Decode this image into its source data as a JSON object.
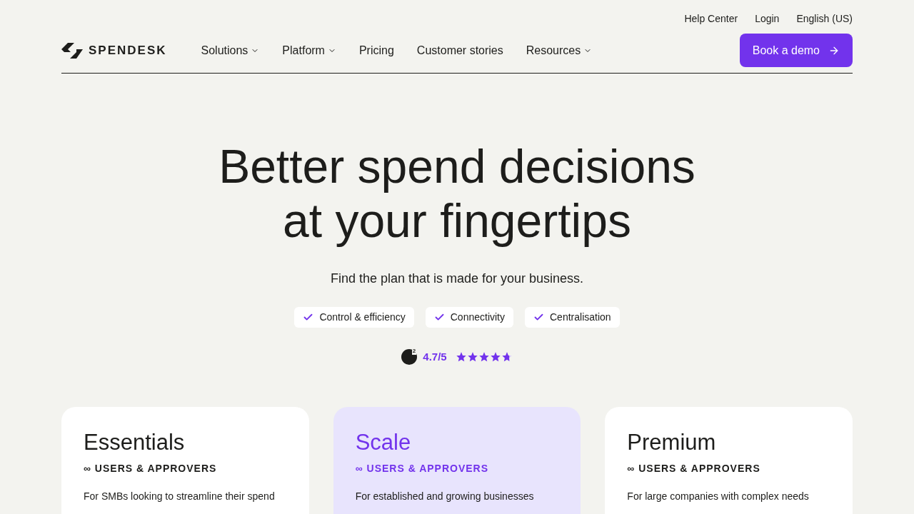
{
  "top_links": [
    "Help Center",
    "Login",
    "English (US)"
  ],
  "logo": {
    "text": "SPENDESK"
  },
  "nav": [
    {
      "label": "Solutions",
      "dropdown": true
    },
    {
      "label": "Platform",
      "dropdown": true
    },
    {
      "label": "Pricing",
      "dropdown": false
    },
    {
      "label": "Customer stories",
      "dropdown": false
    },
    {
      "label": "Resources",
      "dropdown": true
    }
  ],
  "cta": {
    "label": "Book a demo"
  },
  "hero": {
    "title_lines": [
      "Better spend decisions",
      "at your fingertips"
    ],
    "subtitle": "Find the plan that is made for your business.",
    "features": [
      "Control & efficiency",
      "Connectivity",
      "Centralisation"
    ],
    "rating": {
      "g2": "2",
      "score": "4.7/5",
      "stars": 4.7
    }
  },
  "plans": [
    {
      "name": "Essentials",
      "users": "∞ USERS & APPROVERS",
      "description": "For SMBs looking to streamline their spend",
      "highlighted": false
    },
    {
      "name": "Scale",
      "users": "∞ USERS & APPROVERS",
      "description": "For established and growing businesses",
      "highlighted": true
    },
    {
      "name": "Premium",
      "users": "∞ USERS & APPROVERS",
      "description": "For large companies with complex needs",
      "highlighted": false
    }
  ]
}
